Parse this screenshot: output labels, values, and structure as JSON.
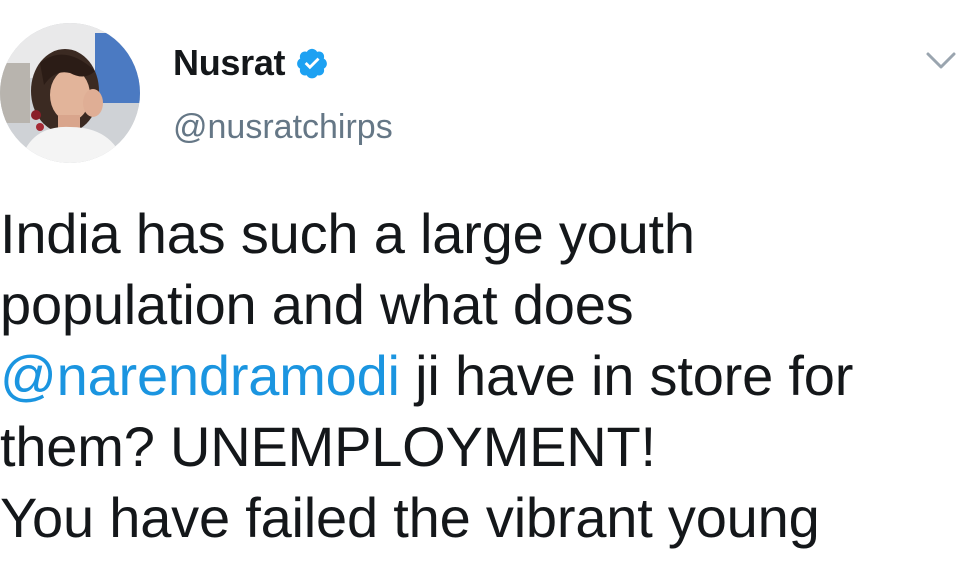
{
  "user": {
    "display_name": "Nusrat",
    "handle": "@nusratchirps",
    "verified": true,
    "avatar_icon": "profile-photo",
    "verified_icon": "verified-badge-icon"
  },
  "menu": {
    "icon": "chevron-down-icon"
  },
  "tweet": {
    "line1": "India has such a large youth",
    "line2": "population and what does",
    "mention": "@narendramodi",
    "line3_rest": " ji have in store for",
    "line4": "them? UNEMPLOYMENT!",
    "line5": "You have failed the vibrant young"
  },
  "colors": {
    "mention": "#1b95e0",
    "verified": "#1da1f2",
    "handle": "#657786",
    "text": "#14171a"
  }
}
